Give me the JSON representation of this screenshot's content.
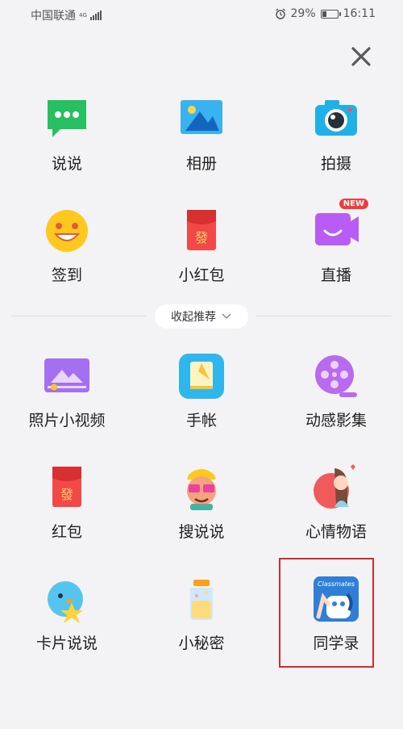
{
  "status_bar": {
    "carrier": "中国联通",
    "network": "4G",
    "battery": "29%",
    "battery_level": 0.29,
    "time": "16:11"
  },
  "close_icon": "close-icon",
  "recommended": [
    {
      "label": "说说",
      "icon": "speech-bubble-icon"
    },
    {
      "label": "相册",
      "icon": "photo-album-icon"
    },
    {
      "label": "拍摄",
      "icon": "camera-icon"
    },
    {
      "label": "签到",
      "icon": "smiley-checkin-icon"
    },
    {
      "label": "小红包",
      "icon": "red-packet-icon"
    },
    {
      "label": "直播",
      "icon": "live-broadcast-icon",
      "badge": "NEW"
    }
  ],
  "collapse_label": "收起推荐",
  "more": [
    {
      "label": "照片小视频",
      "icon": "photo-video-icon"
    },
    {
      "label": "手帐",
      "icon": "notebook-icon"
    },
    {
      "label": "动感影集",
      "icon": "film-reel-icon"
    },
    {
      "label": "红包",
      "icon": "red-envelope-icon"
    },
    {
      "label": "搜说说",
      "icon": "search-character-icon"
    },
    {
      "label": "心情物语",
      "icon": "mood-girl-icon"
    },
    {
      "label": "卡片说说",
      "icon": "card-bird-icon"
    },
    {
      "label": "小秘密",
      "icon": "secret-jar-icon"
    },
    {
      "label": "同学录",
      "icon": "classmates-book-icon",
      "icon_text": "Classmates",
      "selected": true
    }
  ],
  "colors": {
    "background": "#f3f3f5",
    "highlight_border": "#d32b2b",
    "badge_red": "#f23b3b"
  }
}
